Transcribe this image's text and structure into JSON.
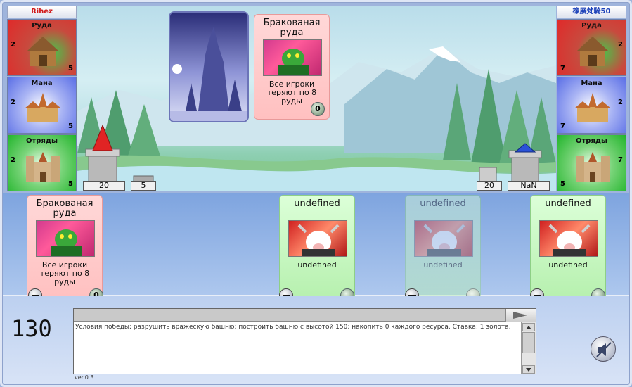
{
  "players": {
    "left": {
      "name": "Rihez",
      "resources": [
        {
          "label": "Руда",
          "production": "2",
          "stock": "5",
          "icon": "mine-icon"
        },
        {
          "label": "Мана",
          "production": "2",
          "stock": "5",
          "icon": "monastery-icon"
        },
        {
          "label": "Отряды",
          "production": "2",
          "stock": "5",
          "icon": "barracks-icon"
        }
      ],
      "tower": "20",
      "wall": "5"
    },
    "right": {
      "name": "橡展梵騎50",
      "resources": [
        {
          "label": "Руда",
          "production": "2",
          "stock": "7",
          "icon": "mine-icon"
        },
        {
          "label": "Мана",
          "production": "2",
          "stock": "7",
          "icon": "monastery-icon"
        },
        {
          "label": "Отряды",
          "production": "7",
          "stock": "5",
          "icon": "barracks-icon"
        }
      ],
      "tower": "20",
      "wall": "NaN"
    }
  },
  "played_card": {
    "title": "Бракованая руда",
    "desc": "Все игроки теряют по 8 руды",
    "cost": "0"
  },
  "hand": [
    {
      "title": "Бракованая руда",
      "desc": "Все игроки теряют по 8 руды",
      "cost": "0",
      "color": "red",
      "faded": false
    },
    {
      "title": "undefined",
      "desc": "undefined",
      "cost": "",
      "color": "green",
      "faded": false
    },
    {
      "title": "undefined",
      "desc": "undefined",
      "cost": "",
      "color": "green",
      "faded": true
    },
    {
      "title": "undefined",
      "desc": "undefined",
      "cost": "",
      "color": "green",
      "faded": false
    }
  ],
  "turn_counter": "130",
  "log": "Условия победы: разрушить вражескую башню; построить башню с высотой 150; накопить 0 каждого ресурса. Ставка: 1 золота.",
  "chat_placeholder": "",
  "version": "ver.0.3",
  "colors": {
    "left_tower": "#e02424",
    "right_tower": "#2a52d8"
  }
}
